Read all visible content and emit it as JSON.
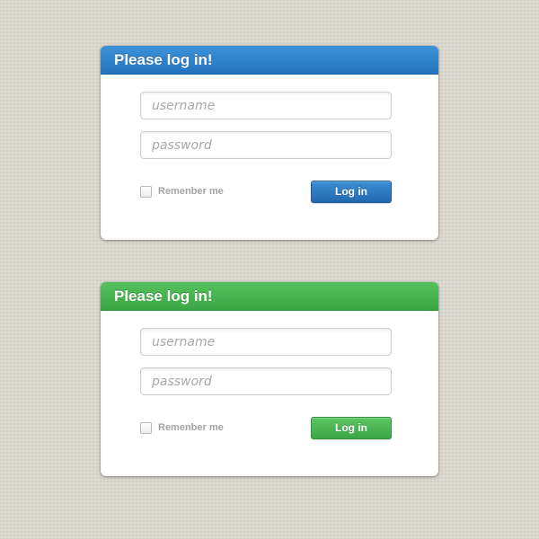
{
  "forms": [
    {
      "theme": "blue",
      "accent_color": "#2a7cc7",
      "title": "Please log in!",
      "username_placeholder": "username",
      "password_placeholder": "password",
      "remember_label": "Remenber me",
      "remember_checked": false,
      "login_label": "Log in"
    },
    {
      "theme": "green",
      "accent_color": "#44b04e",
      "title": "Please log in!",
      "username_placeholder": "username",
      "password_placeholder": "password",
      "remember_label": "Remenber me",
      "remember_checked": false,
      "login_label": "Log in"
    }
  ],
  "background_color": "#d9d6cd",
  "icons": {
    "checkbox": "checkbox-icon"
  }
}
